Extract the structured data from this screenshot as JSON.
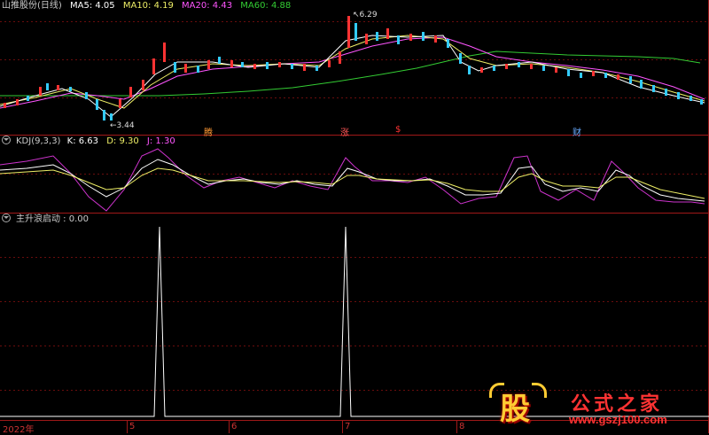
{
  "main_panel": {
    "name": "山推股份(日线)",
    "ma5": "MA5: 4.05",
    "ma10": "MA10: 4.19",
    "ma20": "MA20: 4.43",
    "ma60": "MA60: 4.88",
    "high_label": "6.29",
    "low_label": "3.44",
    "signals": [
      "腾",
      "涨",
      "$",
      "财"
    ]
  },
  "kdj_panel": {
    "name": "KDJ(9,3,3)",
    "k": "K: 6.63",
    "d": "D: 9.30",
    "j": "J: 1.30"
  },
  "ind_panel": {
    "name": "主升浪启动 : 0.00"
  },
  "x_axis": {
    "labels": [
      "2022年",
      "5",
      "6",
      "7",
      "8"
    ]
  },
  "watermark": {
    "logo": "股",
    "title": "公式之家",
    "url": "www.gszj100.com"
  },
  "colors": {
    "up": "#ff3333",
    "down": "#33ccff",
    "ma5": "#ffffff",
    "ma10": "#ffff66",
    "ma20": "#ff66ff",
    "ma60": "#33cc33",
    "grid": "#801010"
  }
}
